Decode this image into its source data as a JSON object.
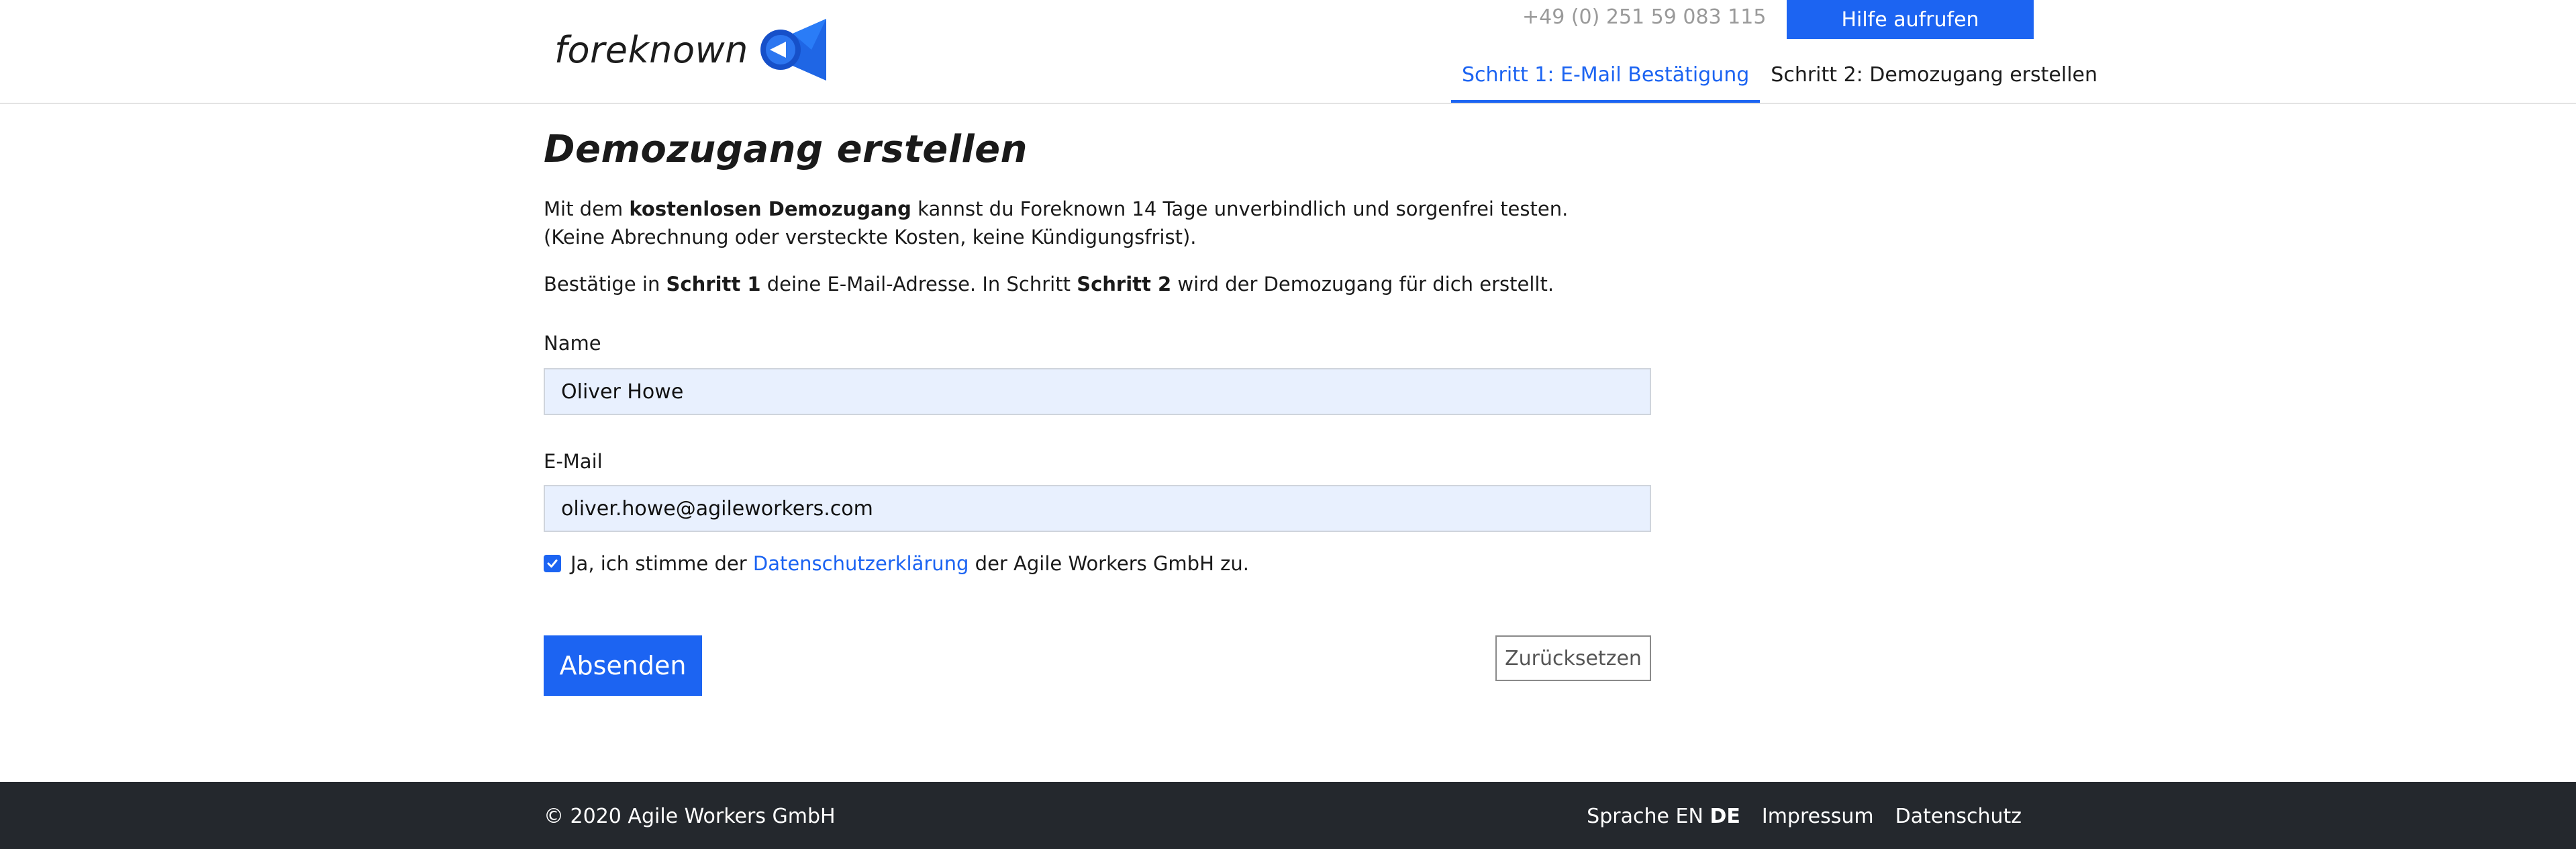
{
  "header": {
    "logo_text": "foreknown",
    "phone": "+49 (0) 251 59 083 115",
    "help_button": "Hilfe aufrufen",
    "steps": [
      {
        "label": "Schritt 1: E-Mail Bestätigung",
        "active": true
      },
      {
        "label": "Schritt 2: Demozugang erstellen",
        "active": false
      }
    ]
  },
  "main": {
    "title": "Demozugang erstellen",
    "intro": {
      "line1_prefix": "Mit dem ",
      "line1_bold": "kostenlosen Demozugang",
      "line1_suffix": " kannst du Foreknown 14 Tage unverbindlich und sorgenfrei testen.",
      "line2": "(Keine Abrechnung oder versteckte Kosten, keine Kündigungsfrist).",
      "line3_a": "Bestätige in ",
      "line3_b": "Schritt 1",
      "line3_c": " deine E-Mail-Adresse. In Schritt ",
      "line3_d": "Schritt 2",
      "line3_e": " wird der Demozugang für dich erstellt."
    },
    "form": {
      "name_label": "Name",
      "name_value": "Oliver Howe",
      "email_label": "E-Mail",
      "email_value": "oliver.howe@agileworkers.com",
      "consent_prefix": "Ja, ich stimme der ",
      "consent_link": "Datenschutzerklärung",
      "consent_suffix": " der Agile Workers GmbH zu.",
      "consent_checked": true,
      "submit": "Absenden",
      "reset": "Zurücksetzen"
    }
  },
  "footer": {
    "copyright": "© 2020 Agile Workers GmbH",
    "language_label": "Sprache",
    "lang_en": "EN",
    "lang_de": "DE",
    "impressum": "Impressum",
    "datenschutz": "Datenschutz"
  },
  "colors": {
    "accent": "#1c64f2",
    "footer_bg": "#24282d",
    "input_bg": "#e8f0fe"
  }
}
